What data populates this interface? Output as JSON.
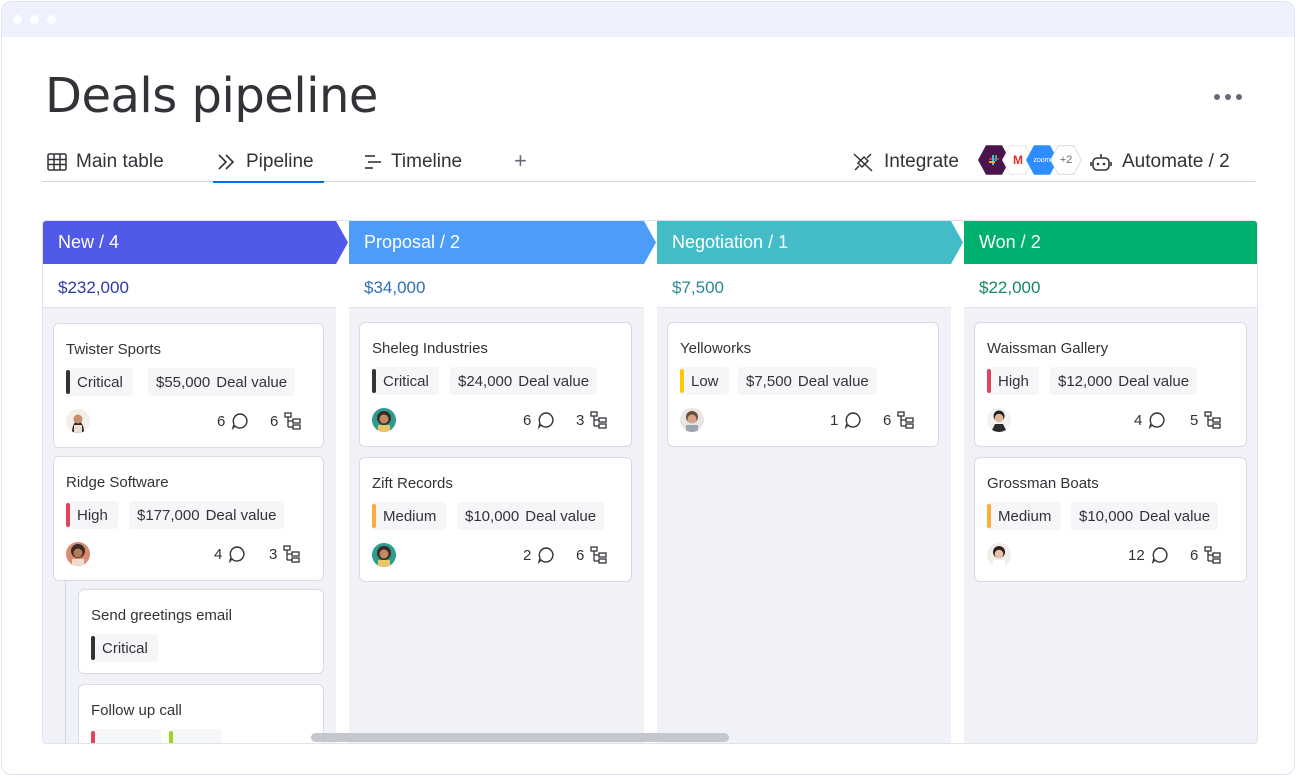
{
  "page": {
    "title": "Deals pipeline"
  },
  "tabs": [
    {
      "label": "Main table",
      "icon": "table-icon"
    },
    {
      "label": "Pipeline",
      "icon": "pipeline-icon",
      "active": true
    },
    {
      "label": "Timeline",
      "icon": "timeline-icon"
    }
  ],
  "toolbar": {
    "add_view": "+",
    "integrate_label": "Integrate",
    "apps": [
      {
        "name": "slack",
        "text": "",
        "color": "#4a154b"
      },
      {
        "name": "gmail",
        "text": "M",
        "color": "#ffffff"
      },
      {
        "name": "zoom",
        "text": "zoom",
        "color": "#2d8cff"
      },
      {
        "name": "more-apps",
        "text": "+2",
        "color": "#ffffff"
      }
    ],
    "automate_label": "Automate / 2"
  },
  "columns": [
    {
      "header": "New / 4",
      "sum": "$232,000",
      "color": "#5059e8",
      "sum_color": "#2f3aa5",
      "cards": [
        {
          "name": "Twister Sports",
          "priority": "Critical",
          "priority_color": "#333333",
          "value": "$55,000",
          "value_label": "Deal value",
          "comments": "6",
          "subitems": "6"
        },
        {
          "name": "Ridge Software",
          "priority": "High",
          "priority_color": "#e2445c",
          "value": "$177,000",
          "value_label": "Deal value",
          "comments": "4",
          "subitems": "3"
        }
      ],
      "subitems": [
        {
          "name": "Send greetings email",
          "priority": "Critical",
          "priority_color": "#333333"
        },
        {
          "name": "Follow up call",
          "priority": "",
          "priority_color": "#e2445c"
        }
      ]
    },
    {
      "header": "Proposal / 2",
      "sum": "$34,000",
      "color": "#4d9cf7",
      "sum_color": "#2f6fb8",
      "cards": [
        {
          "name": "Sheleg Industries",
          "priority": "Critical",
          "priority_color": "#333333",
          "value": "$24,000",
          "value_label": "Deal value",
          "comments": "6",
          "subitems": "3"
        },
        {
          "name": "Zift Records",
          "priority": "Medium",
          "priority_color": "#fdab3d",
          "value": "$10,000",
          "value_label": "Deal value",
          "comments": "2",
          "subitems": "6"
        }
      ]
    },
    {
      "header": "Negotiation / 1",
      "sum": "$7,500",
      "color": "#44bcc7",
      "sum_color": "#2b8a94",
      "cards": [
        {
          "name": "Yelloworks",
          "priority": "Low",
          "priority_color": "#ffcb00",
          "value": "$7,500",
          "value_label": "Deal value",
          "comments": "1",
          "subitems": "6"
        }
      ]
    },
    {
      "header": "Won / 2",
      "sum": "$22,000",
      "color": "#00b06f",
      "sum_color": "#158a62",
      "cards": [
        {
          "name": "Waissman Gallery",
          "priority": "High",
          "priority_color": "#e2445c",
          "value": "$12,000",
          "value_label": "Deal value",
          "comments": "4",
          "subitems": "5"
        },
        {
          "name": "Grossman Boats",
          "priority": "Medium",
          "priority_color": "#fdab3d",
          "value": "$10,000",
          "value_label": "Deal value",
          "comments": "12",
          "subitems": "6"
        }
      ]
    }
  ]
}
